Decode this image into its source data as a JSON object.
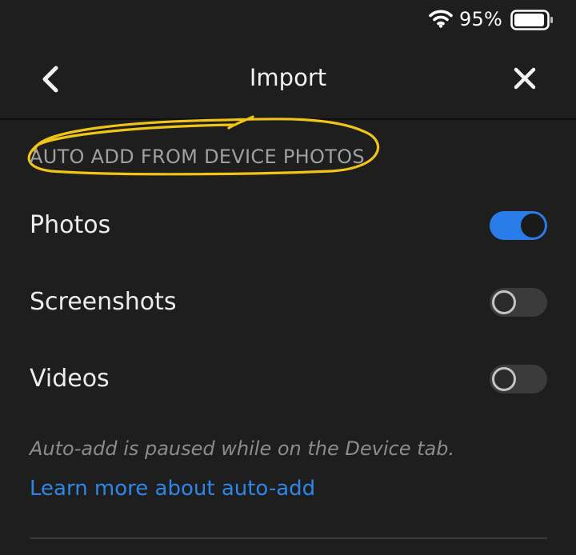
{
  "status_bar": {
    "battery_percent": "95%",
    "battery_level": 0.95,
    "icons": [
      "wifi-icon",
      "battery-icon"
    ]
  },
  "header": {
    "title": "Import",
    "back_icon": "chevron-left-icon",
    "close_icon": "close-icon"
  },
  "section": {
    "title": "AUTO ADD FROM DEVICE PHOTOS",
    "highlight_color": "#f0c419"
  },
  "settings": [
    {
      "label": "Photos",
      "enabled": true
    },
    {
      "label": "Screenshots",
      "enabled": false
    },
    {
      "label": "Videos",
      "enabled": false
    }
  ],
  "footer": {
    "note": "Auto-add is paused while on the Device tab.",
    "link": "Learn more about auto-add"
  },
  "colors": {
    "background": "#1e1e1e",
    "accent": "#2a7de8",
    "link": "#2f86ea"
  }
}
